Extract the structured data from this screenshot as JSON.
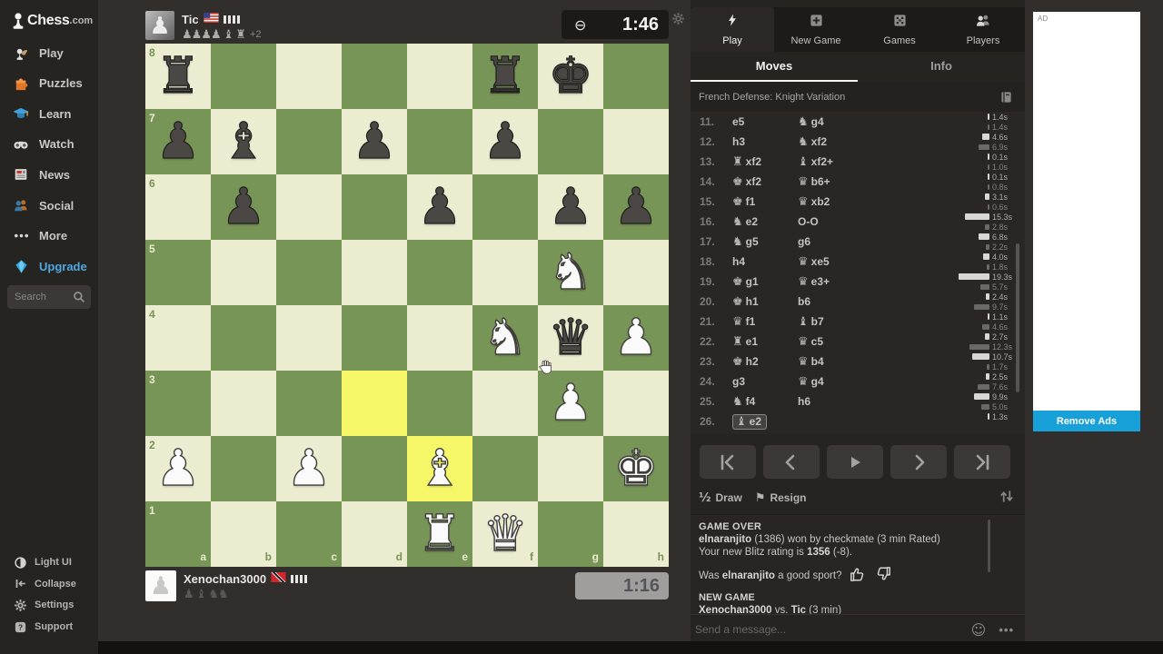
{
  "sidebar": {
    "logo": {
      "main": "Chess",
      "suffix": ".com"
    },
    "items": [
      {
        "id": "play",
        "label": "Play"
      },
      {
        "id": "puzzles",
        "label": "Puzzles"
      },
      {
        "id": "learn",
        "label": "Learn"
      },
      {
        "id": "watch",
        "label": "Watch"
      },
      {
        "id": "news",
        "label": "News"
      },
      {
        "id": "social",
        "label": "Social"
      },
      {
        "id": "more",
        "label": "More"
      },
      {
        "id": "upgrade",
        "label": "Upgrade",
        "color": "#4fa8e0"
      }
    ],
    "search": {
      "placeholder": "Search"
    },
    "footer_items": [
      {
        "id": "light-ui",
        "label": "Light UI"
      },
      {
        "id": "collapse",
        "label": "Collapse"
      },
      {
        "id": "settings",
        "label": "Settings"
      },
      {
        "id": "support",
        "label": "Support"
      }
    ]
  },
  "players": {
    "top": {
      "name": "Tic",
      "flag": "us",
      "streak_bars": 4,
      "captured_color": "white",
      "captured": [
        "pawn",
        "pawn",
        "pawn",
        "pawn",
        "bishop",
        "rook"
      ],
      "advantage": "+2",
      "clock": "1:46",
      "clock_icon": "clock-paused"
    },
    "bottom": {
      "name": "Xenochan3000",
      "flag": "tt",
      "streak_bars": 4,
      "captured_color": "black",
      "captured": [
        "pawn",
        "bishop",
        "knight",
        "knight"
      ],
      "advantage": "",
      "clock": "1:16"
    }
  },
  "board": {
    "light_color": "#ebecd0",
    "dark_color": "#779556",
    "highlight_light": "#f6f669",
    "highlight_dark": "#e2ee7a",
    "ranks": [
      "8",
      "7",
      "6",
      "5",
      "4",
      "3",
      "2",
      "1"
    ],
    "files": [
      "a",
      "b",
      "c",
      "d",
      "e",
      "f",
      "g",
      "h"
    ],
    "highlighted_squares": [
      "d3",
      "e2"
    ],
    "pieces": [
      {
        "square": "a8",
        "color": "black",
        "type": "rook"
      },
      {
        "square": "f8",
        "color": "black",
        "type": "rook"
      },
      {
        "square": "g8",
        "color": "black",
        "type": "king"
      },
      {
        "square": "a7",
        "color": "black",
        "type": "pawn"
      },
      {
        "square": "b7",
        "color": "black",
        "type": "bishop"
      },
      {
        "square": "d7",
        "color": "black",
        "type": "pawn"
      },
      {
        "square": "f7",
        "color": "black",
        "type": "pawn"
      },
      {
        "square": "b6",
        "color": "black",
        "type": "pawn"
      },
      {
        "square": "e6",
        "color": "black",
        "type": "pawn"
      },
      {
        "square": "g6",
        "color": "black",
        "type": "pawn"
      },
      {
        "square": "h6",
        "color": "black",
        "type": "pawn"
      },
      {
        "square": "g5",
        "color": "white",
        "type": "knight"
      },
      {
        "square": "f4",
        "color": "white",
        "type": "knight"
      },
      {
        "square": "g4",
        "color": "black",
        "type": "queen"
      },
      {
        "square": "h4",
        "color": "white",
        "type": "pawn"
      },
      {
        "square": "g3",
        "color": "white",
        "type": "pawn"
      },
      {
        "square": "a2",
        "color": "white",
        "type": "pawn"
      },
      {
        "square": "c2",
        "color": "white",
        "type": "pawn"
      },
      {
        "square": "e2",
        "color": "white",
        "type": "bishop"
      },
      {
        "square": "h2",
        "color": "white",
        "type": "king"
      },
      {
        "square": "e1",
        "color": "white",
        "type": "rook"
      },
      {
        "square": "f1",
        "color": "white",
        "type": "queen"
      }
    ]
  },
  "right_panel": {
    "tabs": [
      {
        "id": "play",
        "label": "Play",
        "active": true
      },
      {
        "id": "new-game",
        "label": "New Game",
        "active": false
      },
      {
        "id": "games",
        "label": "Games",
        "active": false
      },
      {
        "id": "players",
        "label": "Players",
        "active": false
      }
    ],
    "subtabs": {
      "moves": "Moves",
      "info": "Info"
    },
    "opening": "French Defense: Knight Variation",
    "moves": [
      {
        "n": "11.",
        "w": {
          "t": "e5"
        },
        "b": {
          "p": "knight",
          "t": "g4"
        },
        "wt": "1.4s",
        "bt": "1.4s"
      },
      {
        "n": "12.",
        "w": {
          "t": "h3"
        },
        "b": {
          "p": "knight",
          "t": "xf2"
        },
        "wt": "4.6s",
        "bt": "6.9s"
      },
      {
        "n": "13.",
        "w": {
          "p": "rook",
          "t": "xf2"
        },
        "b": {
          "p": "bishop",
          "t": "xf2+"
        },
        "wt": "0.1s",
        "bt": "1.0s"
      },
      {
        "n": "14.",
        "w": {
          "p": "king",
          "t": "xf2"
        },
        "b": {
          "p": "queen",
          "t": "b6+"
        },
        "wt": "0.1s",
        "bt": "0.8s"
      },
      {
        "n": "15.",
        "w": {
          "p": "king",
          "t": "f1"
        },
        "b": {
          "p": "queen",
          "t": "xb2"
        },
        "wt": "3.1s",
        "bt": "0.6s"
      },
      {
        "n": "16.",
        "w": {
          "p": "knight",
          "t": "e2"
        },
        "b": {
          "t": "O-O"
        },
        "wt": "15.3s",
        "bt": "2.8s"
      },
      {
        "n": "17.",
        "w": {
          "p": "knight",
          "t": "g5"
        },
        "b": {
          "t": "g6"
        },
        "wt": "6.8s",
        "bt": "2.2s"
      },
      {
        "n": "18.",
        "w": {
          "t": "h4"
        },
        "b": {
          "p": "queen",
          "t": "xe5"
        },
        "wt": "4.0s",
        "bt": "1.8s"
      },
      {
        "n": "19.",
        "w": {
          "p": "king",
          "t": "g1"
        },
        "b": {
          "p": "queen",
          "t": "e3+"
        },
        "wt": "19.3s",
        "bt": "5.7s"
      },
      {
        "n": "20.",
        "w": {
          "p": "king",
          "t": "h1"
        },
        "b": {
          "t": "b6"
        },
        "wt": "2.4s",
        "bt": "9.7s"
      },
      {
        "n": "21.",
        "w": {
          "p": "queen",
          "t": "f1"
        },
        "b": {
          "p": "bishop",
          "t": "b7"
        },
        "wt": "1.1s",
        "bt": "4.6s"
      },
      {
        "n": "22.",
        "w": {
          "p": "rook",
          "t": "e1"
        },
        "b": {
          "p": "queen",
          "t": "c5"
        },
        "wt": "2.7s",
        "bt": "12.3s"
      },
      {
        "n": "23.",
        "w": {
          "p": "king",
          "t": "h2"
        },
        "b": {
          "p": "queen",
          "t": "b4"
        },
        "wt": "10.7s",
        "bt": "1.7s"
      },
      {
        "n": "24.",
        "w": {
          "t": "g3"
        },
        "b": {
          "p": "queen",
          "t": "g4"
        },
        "wt": "2.5s",
        "bt": "7.6s"
      },
      {
        "n": "25.",
        "w": {
          "p": "knight",
          "t": "f4"
        },
        "b": {
          "t": "h6"
        },
        "wt": "9.9s",
        "bt": "5.0s"
      },
      {
        "n": "26.",
        "w": {
          "p": "bishop",
          "t": "e2",
          "selected": true
        },
        "wt": "1.3s",
        "bt": ""
      }
    ],
    "controls": {
      "draw": "Draw",
      "resign": "Resign"
    },
    "game_over": {
      "title": "GAME OVER",
      "result_name": "elnaranjito",
      "result_rest": " (1386) won by checkmate (3 min Rated)",
      "rating_pre": "Your new Blitz rating is ",
      "rating_value": "1356",
      "rating_post": " (-8).",
      "sport_pre": "Was ",
      "sport_name": "elnaranjito",
      "sport_post": " a good sport?",
      "new_game_title": "NEW GAME",
      "new_game_p1": "Xenochan3000",
      "new_game_vs": " vs. ",
      "new_game_p2": "Tic",
      "new_game_time": " (3 min)"
    },
    "chat": {
      "placeholder": "Send a message..."
    }
  },
  "ad": {
    "label": "AD",
    "remove_button": "Remove Ads",
    "button_color": "#18a1d9"
  }
}
